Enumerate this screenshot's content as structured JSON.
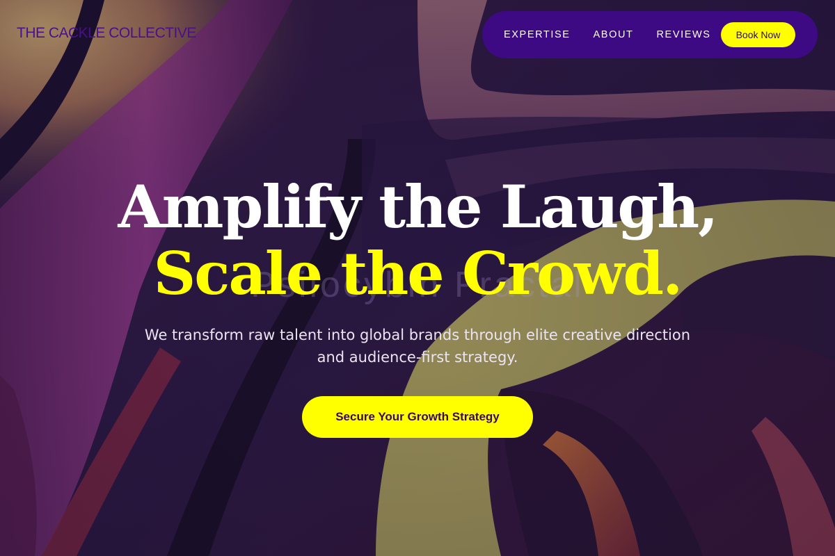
{
  "brand": {
    "logo_text": "THE CACKLE COLLECTIVE"
  },
  "nav": {
    "links": [
      {
        "label": "EXPERTISE"
      },
      {
        "label": "ABOUT"
      },
      {
        "label": "REVIEWS"
      }
    ],
    "book_label": "Book Now"
  },
  "hero": {
    "headline_line1": "Amplify the Laugh,",
    "headline_line2": "Scale the Crowd.",
    "ghost_text": "Psilocybin Fractal",
    "subtitle": "We transform raw talent into global brands through elite creative direction and audience-first strategy.",
    "cta_label": "Secure Your Growth Strategy"
  },
  "colors": {
    "accent": "#ffff00",
    "nav_bg": "#3d0a84",
    "logo": "#4a0f8a",
    "text_light": "#ffffff"
  }
}
